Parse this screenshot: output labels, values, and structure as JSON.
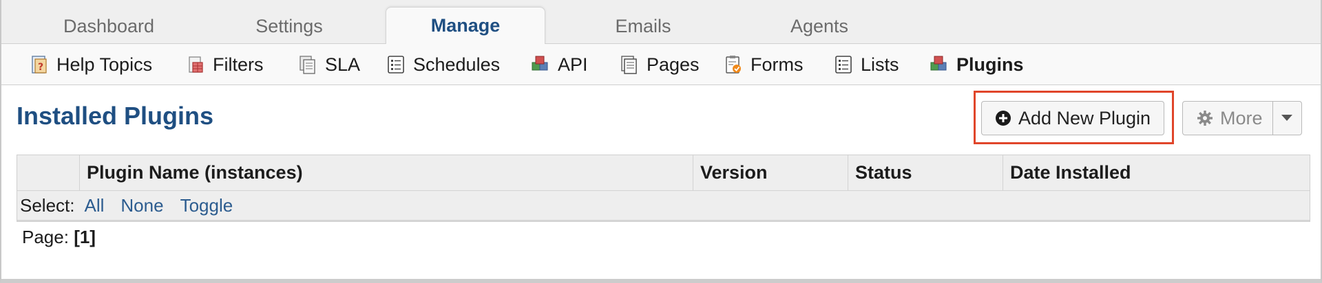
{
  "top_tabs": [
    {
      "label": "Dashboard",
      "active": false
    },
    {
      "label": "Settings",
      "active": false
    },
    {
      "label": "Manage",
      "active": true
    },
    {
      "label": "Emails",
      "active": false
    },
    {
      "label": "Agents",
      "active": false
    }
  ],
  "sub_nav": [
    {
      "label": "Help Topics",
      "icon": "help-topics-icon"
    },
    {
      "label": "Filters",
      "icon": "filters-icon"
    },
    {
      "label": "SLA",
      "icon": "sla-icon"
    },
    {
      "label": "Schedules",
      "icon": "schedules-icon"
    },
    {
      "label": "API",
      "icon": "api-icon"
    },
    {
      "label": "Pages",
      "icon": "pages-icon"
    },
    {
      "label": "Forms",
      "icon": "forms-icon"
    },
    {
      "label": "Lists",
      "icon": "lists-icon"
    },
    {
      "label": "Plugins",
      "icon": "plugins-icon",
      "active": true
    }
  ],
  "main": {
    "title": "Installed Plugins",
    "add_button_label": "Add New Plugin",
    "more_button_label": "More"
  },
  "table": {
    "columns": [
      "",
      "Plugin Name (instances)",
      "Version",
      "Status",
      "Date Installed"
    ],
    "select_label": "Select:",
    "select_links": [
      "All",
      "None",
      "Toggle"
    ]
  },
  "pager": {
    "label": "Page:",
    "current": "[1]"
  },
  "colors": {
    "accent": "#1f4f82",
    "link": "#2c5c8f",
    "highlight": "#e0452a"
  }
}
